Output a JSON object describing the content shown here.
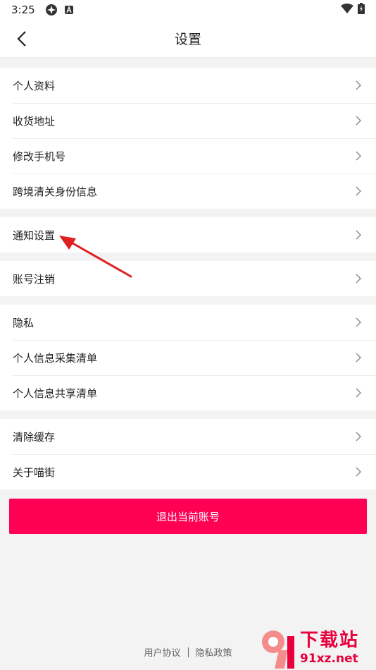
{
  "status_bar": {
    "time": "3:25",
    "icons": [
      "app-icon",
      "a-icon"
    ],
    "right_icons": [
      "wifi-icon",
      "battery-icon"
    ]
  },
  "nav": {
    "title": "设置",
    "back_icon": "chevron-left-icon"
  },
  "groups": [
    {
      "items": [
        {
          "label": "个人资料"
        },
        {
          "label": "收货地址"
        },
        {
          "label": "修改手机号"
        },
        {
          "label": "跨境清关身份信息"
        }
      ]
    },
    {
      "items": [
        {
          "label": "通知设置"
        }
      ]
    },
    {
      "items": [
        {
          "label": "账号注销"
        }
      ]
    },
    {
      "items": [
        {
          "label": "隐私"
        },
        {
          "label": "个人信息采集清单"
        },
        {
          "label": "个人信息共享清单"
        }
      ]
    },
    {
      "items": [
        {
          "label": "清除缓存"
        },
        {
          "label": "关于喵街"
        }
      ]
    }
  ],
  "logout_label": "退出当前账号",
  "footer": {
    "user_agreement": "用户协议",
    "privacy_policy": "隐私政策"
  },
  "watermark": {
    "text_big": "下载站",
    "text_small": "91xz.net"
  },
  "colors": {
    "accent": "#ff0055",
    "annotation_arrow": "#e02020",
    "background": "#f3f3f3"
  }
}
